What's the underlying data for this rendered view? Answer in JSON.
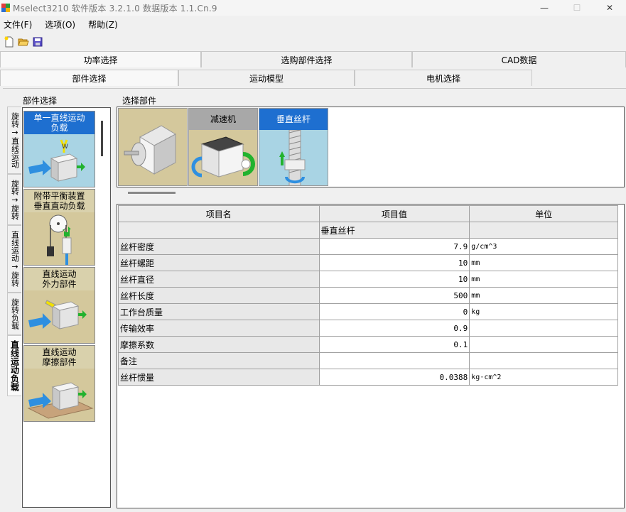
{
  "window": {
    "title": "Mselect3210  软件版本  3.2.1.0    数据版本  1.1.Cn.9",
    "minimize": "—",
    "maximize": "☐",
    "close": "✕"
  },
  "menu": [
    "文件(F)",
    "选项(O)",
    "帮助(Z)"
  ],
  "tabs_top": [
    "功率选择",
    "选购部件选择",
    "CAD数据"
  ],
  "tabs_second": [
    "部件选择",
    "运动模型",
    "电机选择"
  ],
  "vertical_tabs": [
    "旋转→直线运动",
    "旋转→旋转",
    "直线运动→旋转",
    "旋转负载",
    "直线运动负载"
  ],
  "part_list": {
    "label": "部件选择",
    "items": [
      {
        "title": "单一直线运动负载",
        "line1": "单一直线运动",
        "line2": "负载",
        "selected": true
      },
      {
        "title": "附带平衡装置垂直直动负载",
        "line1": "附带平衡装置",
        "line2": "垂直直动负载",
        "selected": false
      },
      {
        "title": "直线运动外力部件",
        "line1": "直线运动",
        "line2": "外力部件",
        "selected": false
      },
      {
        "title": "直线运动摩擦部件",
        "line1": "直线运动",
        "line2": "摩擦部件",
        "selected": false
      }
    ]
  },
  "selected_parts": {
    "label": "选择部件",
    "items": [
      {
        "title": ""
      },
      {
        "title": "减速机"
      },
      {
        "title": "垂直丝杆"
      }
    ]
  },
  "grid": {
    "headers": [
      "项目名",
      "项目值",
      "单位"
    ],
    "subheader": "垂直丝杆",
    "rows": [
      {
        "name": "丝杆密度",
        "value": "7.9",
        "unit": "g/cm^3"
      },
      {
        "name": "丝杆螺距",
        "value": "10",
        "unit": "mm"
      },
      {
        "name": "丝杆直径",
        "value": "10",
        "unit": "mm"
      },
      {
        "name": "丝杆长度",
        "value": "500",
        "unit": "mm"
      },
      {
        "name": "工作台质量",
        "value": "0",
        "unit": "kg"
      },
      {
        "name": "传输效率",
        "value": "0.9",
        "unit": ""
      },
      {
        "name": "摩擦系数",
        "value": "0.1",
        "unit": ""
      },
      {
        "name": "备注",
        "value": "",
        "unit": ""
      },
      {
        "name": "丝杆惯量",
        "value": "0.0388",
        "unit": "kg·cm^2"
      }
    ]
  },
  "colors": {
    "selected": "#1e6fd0",
    "card_bg": "#d4c89c",
    "header_gray": "#a8a8a8"
  }
}
